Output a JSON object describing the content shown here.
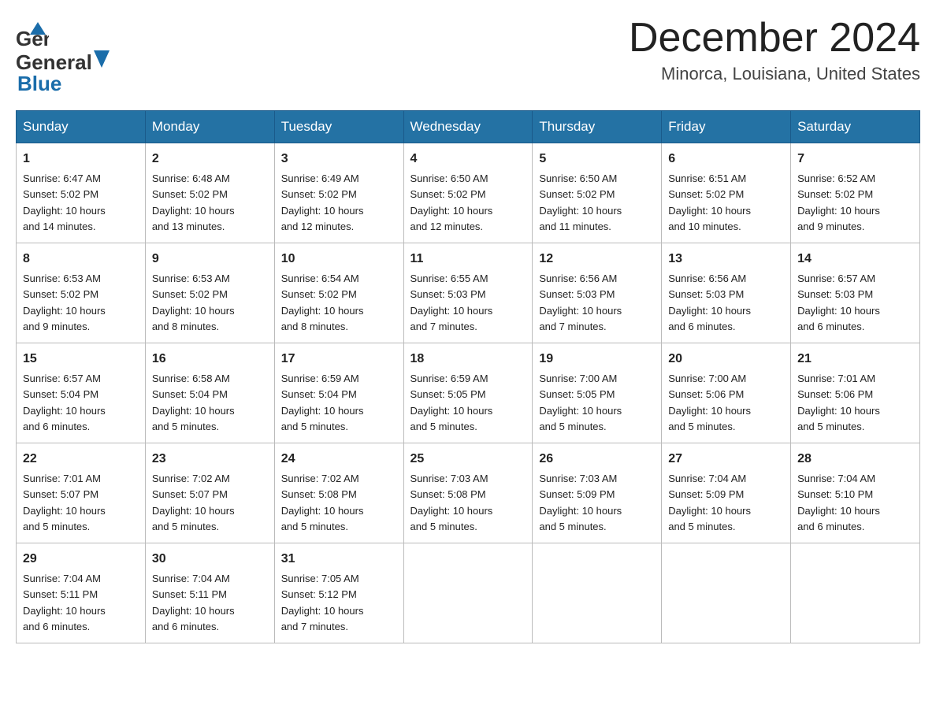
{
  "header": {
    "logo_general": "General",
    "logo_blue": "Blue",
    "month_title": "December 2024",
    "subtitle": "Minorca, Louisiana, United States"
  },
  "weekdays": [
    "Sunday",
    "Monday",
    "Tuesday",
    "Wednesday",
    "Thursday",
    "Friday",
    "Saturday"
  ],
  "weeks": [
    [
      {
        "day": "1",
        "sunrise": "6:47 AM",
        "sunset": "5:02 PM",
        "daylight": "10 hours and 14 minutes."
      },
      {
        "day": "2",
        "sunrise": "6:48 AM",
        "sunset": "5:02 PM",
        "daylight": "10 hours and 13 minutes."
      },
      {
        "day": "3",
        "sunrise": "6:49 AM",
        "sunset": "5:02 PM",
        "daylight": "10 hours and 12 minutes."
      },
      {
        "day": "4",
        "sunrise": "6:50 AM",
        "sunset": "5:02 PM",
        "daylight": "10 hours and 12 minutes."
      },
      {
        "day": "5",
        "sunrise": "6:50 AM",
        "sunset": "5:02 PM",
        "daylight": "10 hours and 11 minutes."
      },
      {
        "day": "6",
        "sunrise": "6:51 AM",
        "sunset": "5:02 PM",
        "daylight": "10 hours and 10 minutes."
      },
      {
        "day": "7",
        "sunrise": "6:52 AM",
        "sunset": "5:02 PM",
        "daylight": "10 hours and 9 minutes."
      }
    ],
    [
      {
        "day": "8",
        "sunrise": "6:53 AM",
        "sunset": "5:02 PM",
        "daylight": "10 hours and 9 minutes."
      },
      {
        "day": "9",
        "sunrise": "6:53 AM",
        "sunset": "5:02 PM",
        "daylight": "10 hours and 8 minutes."
      },
      {
        "day": "10",
        "sunrise": "6:54 AM",
        "sunset": "5:02 PM",
        "daylight": "10 hours and 8 minutes."
      },
      {
        "day": "11",
        "sunrise": "6:55 AM",
        "sunset": "5:03 PM",
        "daylight": "10 hours and 7 minutes."
      },
      {
        "day": "12",
        "sunrise": "6:56 AM",
        "sunset": "5:03 PM",
        "daylight": "10 hours and 7 minutes."
      },
      {
        "day": "13",
        "sunrise": "6:56 AM",
        "sunset": "5:03 PM",
        "daylight": "10 hours and 6 minutes."
      },
      {
        "day": "14",
        "sunrise": "6:57 AM",
        "sunset": "5:03 PM",
        "daylight": "10 hours and 6 minutes."
      }
    ],
    [
      {
        "day": "15",
        "sunrise": "6:57 AM",
        "sunset": "5:04 PM",
        "daylight": "10 hours and 6 minutes."
      },
      {
        "day": "16",
        "sunrise": "6:58 AM",
        "sunset": "5:04 PM",
        "daylight": "10 hours and 5 minutes."
      },
      {
        "day": "17",
        "sunrise": "6:59 AM",
        "sunset": "5:04 PM",
        "daylight": "10 hours and 5 minutes."
      },
      {
        "day": "18",
        "sunrise": "6:59 AM",
        "sunset": "5:05 PM",
        "daylight": "10 hours and 5 minutes."
      },
      {
        "day": "19",
        "sunrise": "7:00 AM",
        "sunset": "5:05 PM",
        "daylight": "10 hours and 5 minutes."
      },
      {
        "day": "20",
        "sunrise": "7:00 AM",
        "sunset": "5:06 PM",
        "daylight": "10 hours and 5 minutes."
      },
      {
        "day": "21",
        "sunrise": "7:01 AM",
        "sunset": "5:06 PM",
        "daylight": "10 hours and 5 minutes."
      }
    ],
    [
      {
        "day": "22",
        "sunrise": "7:01 AM",
        "sunset": "5:07 PM",
        "daylight": "10 hours and 5 minutes."
      },
      {
        "day": "23",
        "sunrise": "7:02 AM",
        "sunset": "5:07 PM",
        "daylight": "10 hours and 5 minutes."
      },
      {
        "day": "24",
        "sunrise": "7:02 AM",
        "sunset": "5:08 PM",
        "daylight": "10 hours and 5 minutes."
      },
      {
        "day": "25",
        "sunrise": "7:03 AM",
        "sunset": "5:08 PM",
        "daylight": "10 hours and 5 minutes."
      },
      {
        "day": "26",
        "sunrise": "7:03 AM",
        "sunset": "5:09 PM",
        "daylight": "10 hours and 5 minutes."
      },
      {
        "day": "27",
        "sunrise": "7:04 AM",
        "sunset": "5:09 PM",
        "daylight": "10 hours and 5 minutes."
      },
      {
        "day": "28",
        "sunrise": "7:04 AM",
        "sunset": "5:10 PM",
        "daylight": "10 hours and 6 minutes."
      }
    ],
    [
      {
        "day": "29",
        "sunrise": "7:04 AM",
        "sunset": "5:11 PM",
        "daylight": "10 hours and 6 minutes."
      },
      {
        "day": "30",
        "sunrise": "7:04 AM",
        "sunset": "5:11 PM",
        "daylight": "10 hours and 6 minutes."
      },
      {
        "day": "31",
        "sunrise": "7:05 AM",
        "sunset": "5:12 PM",
        "daylight": "10 hours and 7 minutes."
      },
      null,
      null,
      null,
      null
    ]
  ],
  "labels": {
    "sunrise": "Sunrise:",
    "sunset": "Sunset:",
    "daylight": "Daylight:"
  }
}
